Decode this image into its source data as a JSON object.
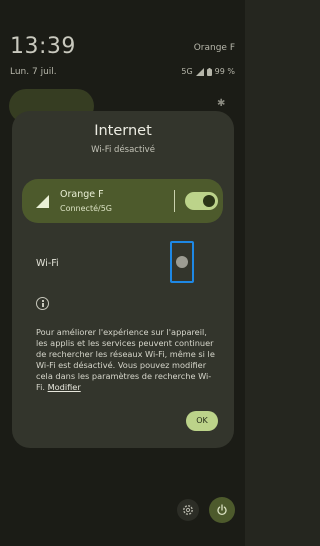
{
  "status_bar": {
    "time": "13:39",
    "date": "Lun. 7 juil.",
    "carrier": "Orange F",
    "network": "5G",
    "battery": "99 %"
  },
  "dialog": {
    "title": "Internet",
    "subtitle": "Wi-Fi désactivé",
    "carrier_card": {
      "name": "Orange F",
      "status": "Connecté/5G",
      "toggle_on": true
    },
    "wifi": {
      "label": "Wi-Fi",
      "toggle_on": false
    },
    "info_text": "Pour améliorer l'expérience sur l'appareil, les applis et les services peuvent continuer de rechercher les réseaux Wi-Fi, même si le Wi-Fi est désactivé. Vous pouvez modifier cela dans les paramètres de recherche Wi-Fi.",
    "info_link": "Modifier",
    "ok_label": "OK"
  },
  "icons": {
    "signal": "signal-icon",
    "info": "info-icon",
    "settings": "gear-icon",
    "power": "power-icon"
  },
  "colors": {
    "accent": "#bcd38a",
    "card": "#4d5a2c",
    "dialog_bg": "#33352c",
    "highlight": "#1e88e5"
  }
}
